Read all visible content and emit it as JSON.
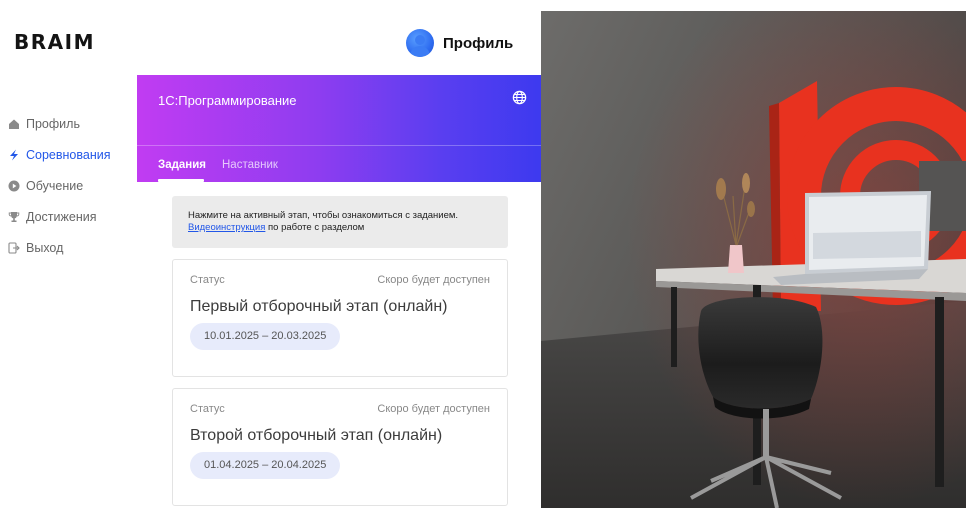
{
  "app": {
    "logo_text": "BRAIM",
    "profile_label": "Профиль"
  },
  "sidebar": {
    "items": [
      {
        "label": "Профиль",
        "icon": "home-icon",
        "active": false
      },
      {
        "label": "Соревнования",
        "icon": "lightning-icon",
        "active": true
      },
      {
        "label": "Обучение",
        "icon": "play-icon",
        "active": false
      },
      {
        "label": "Достижения",
        "icon": "trophy-icon",
        "active": false
      },
      {
        "label": "Выход",
        "icon": "logout-icon",
        "active": false
      }
    ]
  },
  "banner": {
    "title": "1С:Программирование",
    "tabs": [
      {
        "label": "Задания",
        "active": true
      },
      {
        "label": "Наставник",
        "active": false
      }
    ]
  },
  "info": {
    "line1": "Нажмите на активный этап, чтобы ознакомиться с заданием.",
    "link_text": "Видеоинструкция",
    "line2_rest": " по работе с разделом"
  },
  "stages": [
    {
      "status_label": "Статус",
      "availability": "Скоро будет доступен",
      "title": "Первый отборочный этап (онлайн)",
      "dates": "10.01.2025 – 20.03.2025"
    },
    {
      "status_label": "Статус",
      "availability": "Скоро будет доступен",
      "title": "Второй отборочный этап (онлайн)",
      "dates": "01.04.2025 – 20.04.2025"
    }
  ],
  "photo": {
    "sign_text": "1С"
  },
  "colors": {
    "accent": "#2257e8",
    "banner_gradient_start": "#c13cf2",
    "banner_gradient_end": "#3d3aef",
    "sign_red": "#e8321f"
  }
}
